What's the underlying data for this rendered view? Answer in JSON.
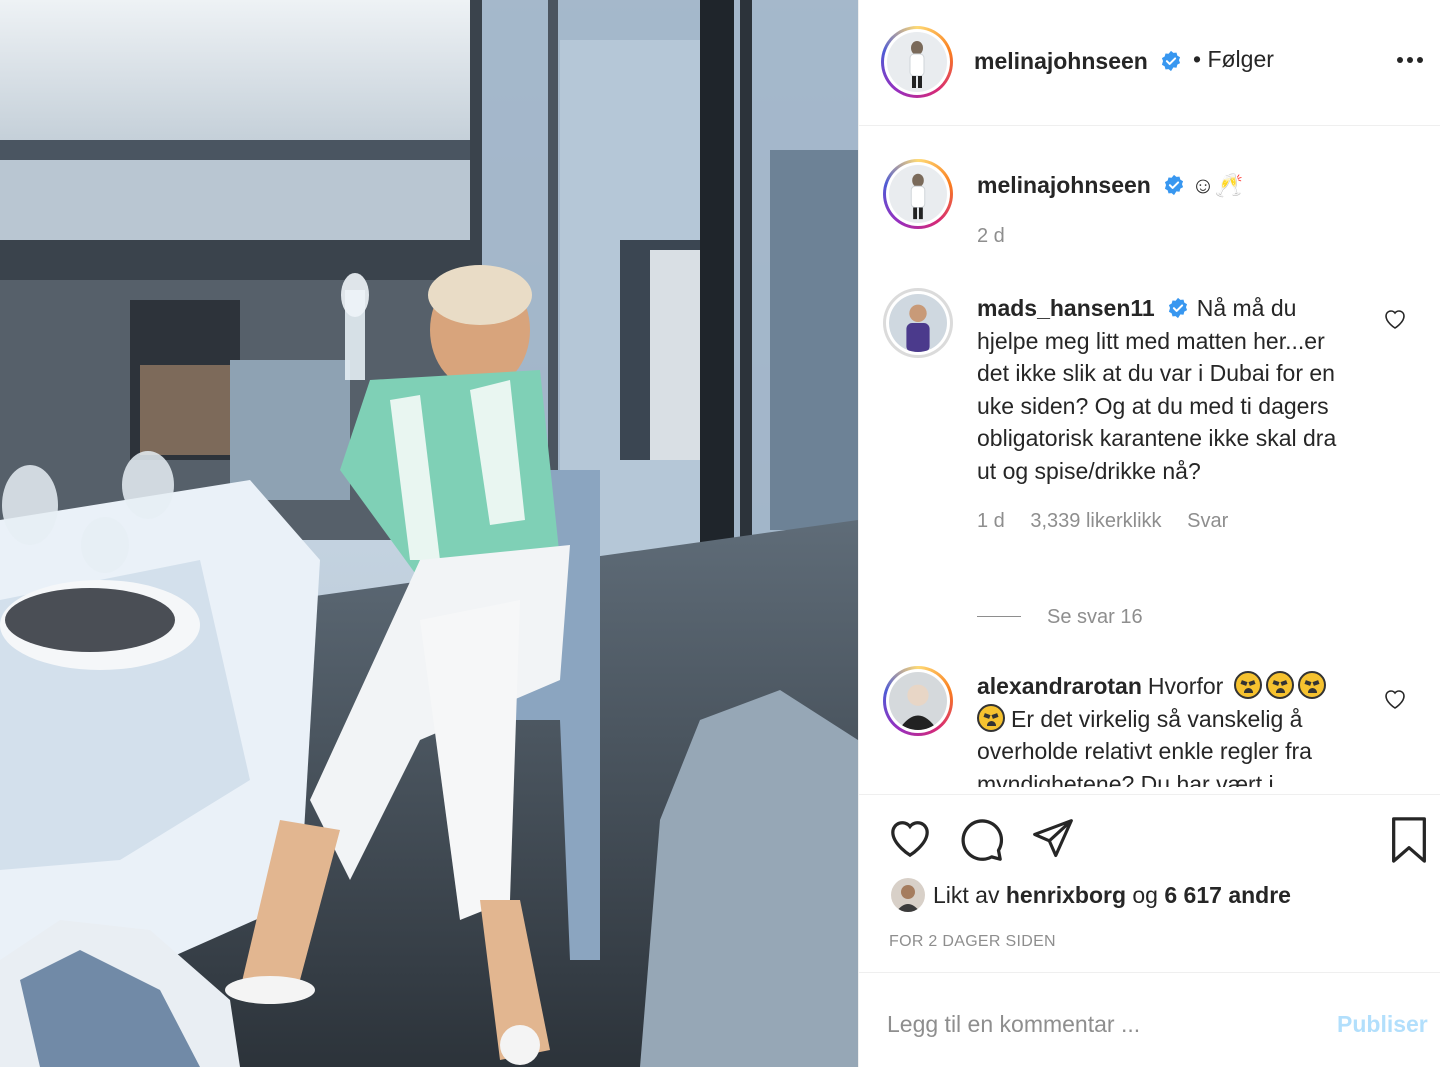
{
  "post": {
    "author": "melinajohnseen",
    "follow_label": "• Følger",
    "caption_text": "☺🥂",
    "caption_age": "2 d"
  },
  "comments": [
    {
      "user": "mads_hansen11",
      "text": "Nå må du hjelpe meg litt med matten her...er det ikke slik at du var i Dubai for en uke siden? Og at du med ti dagers obligatorisk karantene ikke skal dra ut og spise/drikke nå?",
      "age": "1 d",
      "likes": "3,339 likerklikk",
      "reply": "Svar",
      "view_replies": "Se svar 16"
    },
    {
      "user": "alexandrarotan",
      "text_start": "Hvorfor",
      "text_rest": "Er det virkelig så vanskelig å overholde relativt enkle regler fra myndighetene? Du har vært i"
    }
  ],
  "likes": {
    "prefix": "Likt av",
    "user": "henrixborg",
    "middle": "og",
    "count": "6 617 andre"
  },
  "timestamp": "FOR 2 DAGER SIDEN",
  "add_comment": {
    "placeholder": "Legg til en kommentar ...",
    "publish": "Publiser"
  },
  "icons": {
    "like": "heart-icon",
    "comment": "comment-bubble-icon",
    "share": "paper-plane-icon",
    "save": "bookmark-icon",
    "more": "more-dots-icon",
    "verified": "verified-badge-icon"
  },
  "colors": {
    "verified": "#3897f0",
    "publish_disabled": "#b2dffc",
    "secondary_text": "#8e8e8e"
  }
}
